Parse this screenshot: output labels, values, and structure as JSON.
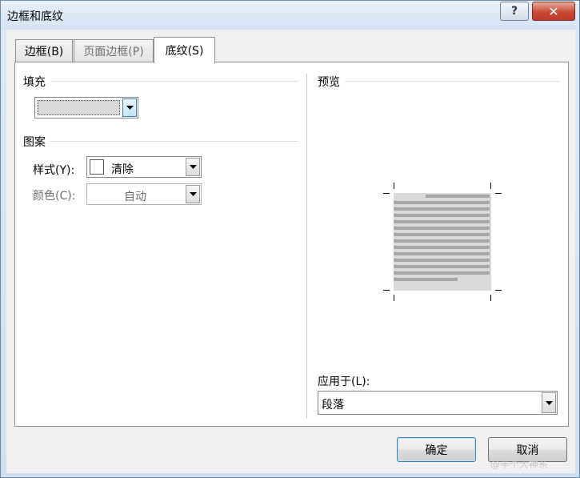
{
  "window": {
    "title": "边框和底纹"
  },
  "titlebar": {
    "help_label": "?",
    "close_label": "✕"
  },
  "tabs": [
    {
      "label": "边框(B)",
      "active": false,
      "disabled": false
    },
    {
      "label": "页面边框(P)",
      "active": false,
      "disabled": false
    },
    {
      "label": "底纹(S)",
      "active": true,
      "disabled": false
    }
  ],
  "fill": {
    "label": "填充",
    "selected_color": "#d9d9d9"
  },
  "pattern": {
    "label": "图案",
    "style_label": "样式(Y):",
    "style_value": "清除",
    "color_label": "颜色(C):",
    "color_value": "自动"
  },
  "preview": {
    "label": "预览"
  },
  "apply_to": {
    "label": "应用于(L):",
    "value": "段落"
  },
  "buttons": {
    "ok": "确定",
    "cancel": "取消"
  },
  "watermark": "@半个大神系",
  "colors": {
    "accent": "#3c7fb1",
    "preview_fill": "#d9d9d9",
    "preview_lines": "#a6a6a6"
  }
}
